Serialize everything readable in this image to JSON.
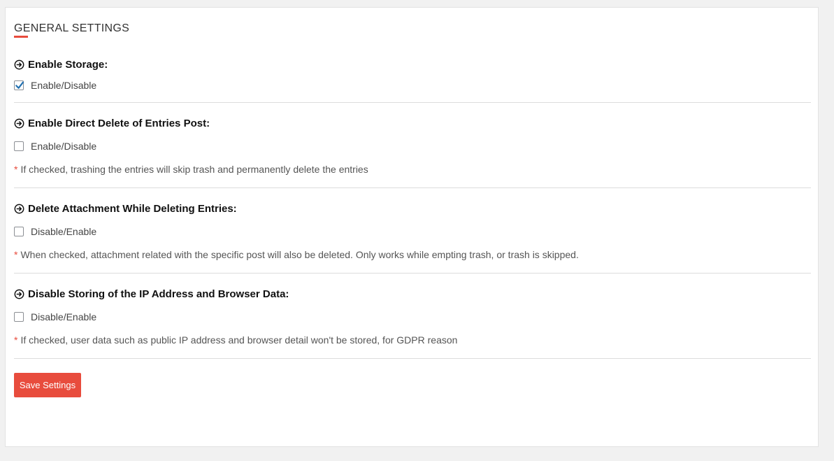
{
  "page": {
    "title": "GENERAL SETTINGS",
    "accent_color": "#e84c3d"
  },
  "sections": [
    {
      "heading": "Enable Storage:",
      "icon": "arrow-circle-right-icon",
      "option_label": "Enable/Disable",
      "checked": true
    },
    {
      "heading": "Enable Direct Delete of Entries Post:",
      "icon": "arrow-circle-right-icon",
      "option_label": "Enable/Disable",
      "checked": false,
      "note_marker": "*",
      "note": "If checked, trashing the entries will skip trash and permanently delete the entries"
    },
    {
      "heading": "Delete Attachment While Deleting Entries:",
      "icon": "arrow-circle-right-icon",
      "option_label": "Disable/Enable",
      "checked": false,
      "note_marker": "*",
      "note": "When checked, attachment related with the specific post will also be deleted. Only works while empting trash, or trash is skipped."
    },
    {
      "heading": "Disable Storing of the IP Address and Browser Data:",
      "icon": "arrow-circle-right-icon",
      "option_label": "Disable/Enable",
      "checked": false,
      "note_marker": "*",
      "note": "If checked, user data such as public IP address and browser detail won't be stored, for GDPR reason"
    }
  ],
  "actions": {
    "save_label": "Save Settings"
  }
}
